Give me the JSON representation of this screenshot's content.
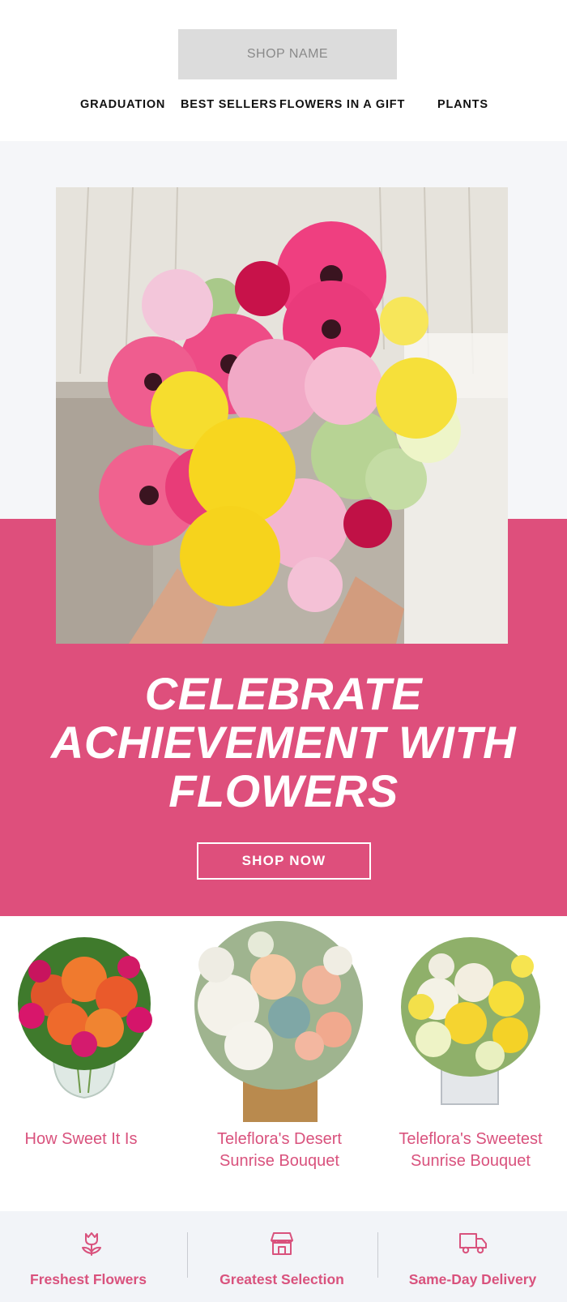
{
  "header": {
    "shop_name": "SHOP NAME",
    "nav": [
      {
        "label": "GRADUATION"
      },
      {
        "label": "BEST SELLERS"
      },
      {
        "label": "FLOWERS IN A GIFT"
      },
      {
        "label": "PLANTS"
      }
    ]
  },
  "hero": {
    "title_lines": [
      "CELEBRATE",
      "ACHIEVEMENT WITH",
      "FLOWERS"
    ],
    "cta": "SHOP NOW",
    "accent_color": "#de4f7c"
  },
  "products": [
    {
      "name_lines": [
        "How Sweet It Is"
      ]
    },
    {
      "name_lines": [
        "Teleflora's Desert",
        "Sunrise Bouquet"
      ]
    },
    {
      "name_lines": [
        "Teleflora's Sweetest",
        "Sunrise Bouquet"
      ]
    }
  ],
  "features": [
    {
      "label": "Freshest Flowers",
      "icon": "tulip-icon"
    },
    {
      "label": "Greatest Selection",
      "icon": "storefront-icon"
    },
    {
      "label": "Same-Day Delivery",
      "icon": "delivery-truck-icon"
    }
  ]
}
